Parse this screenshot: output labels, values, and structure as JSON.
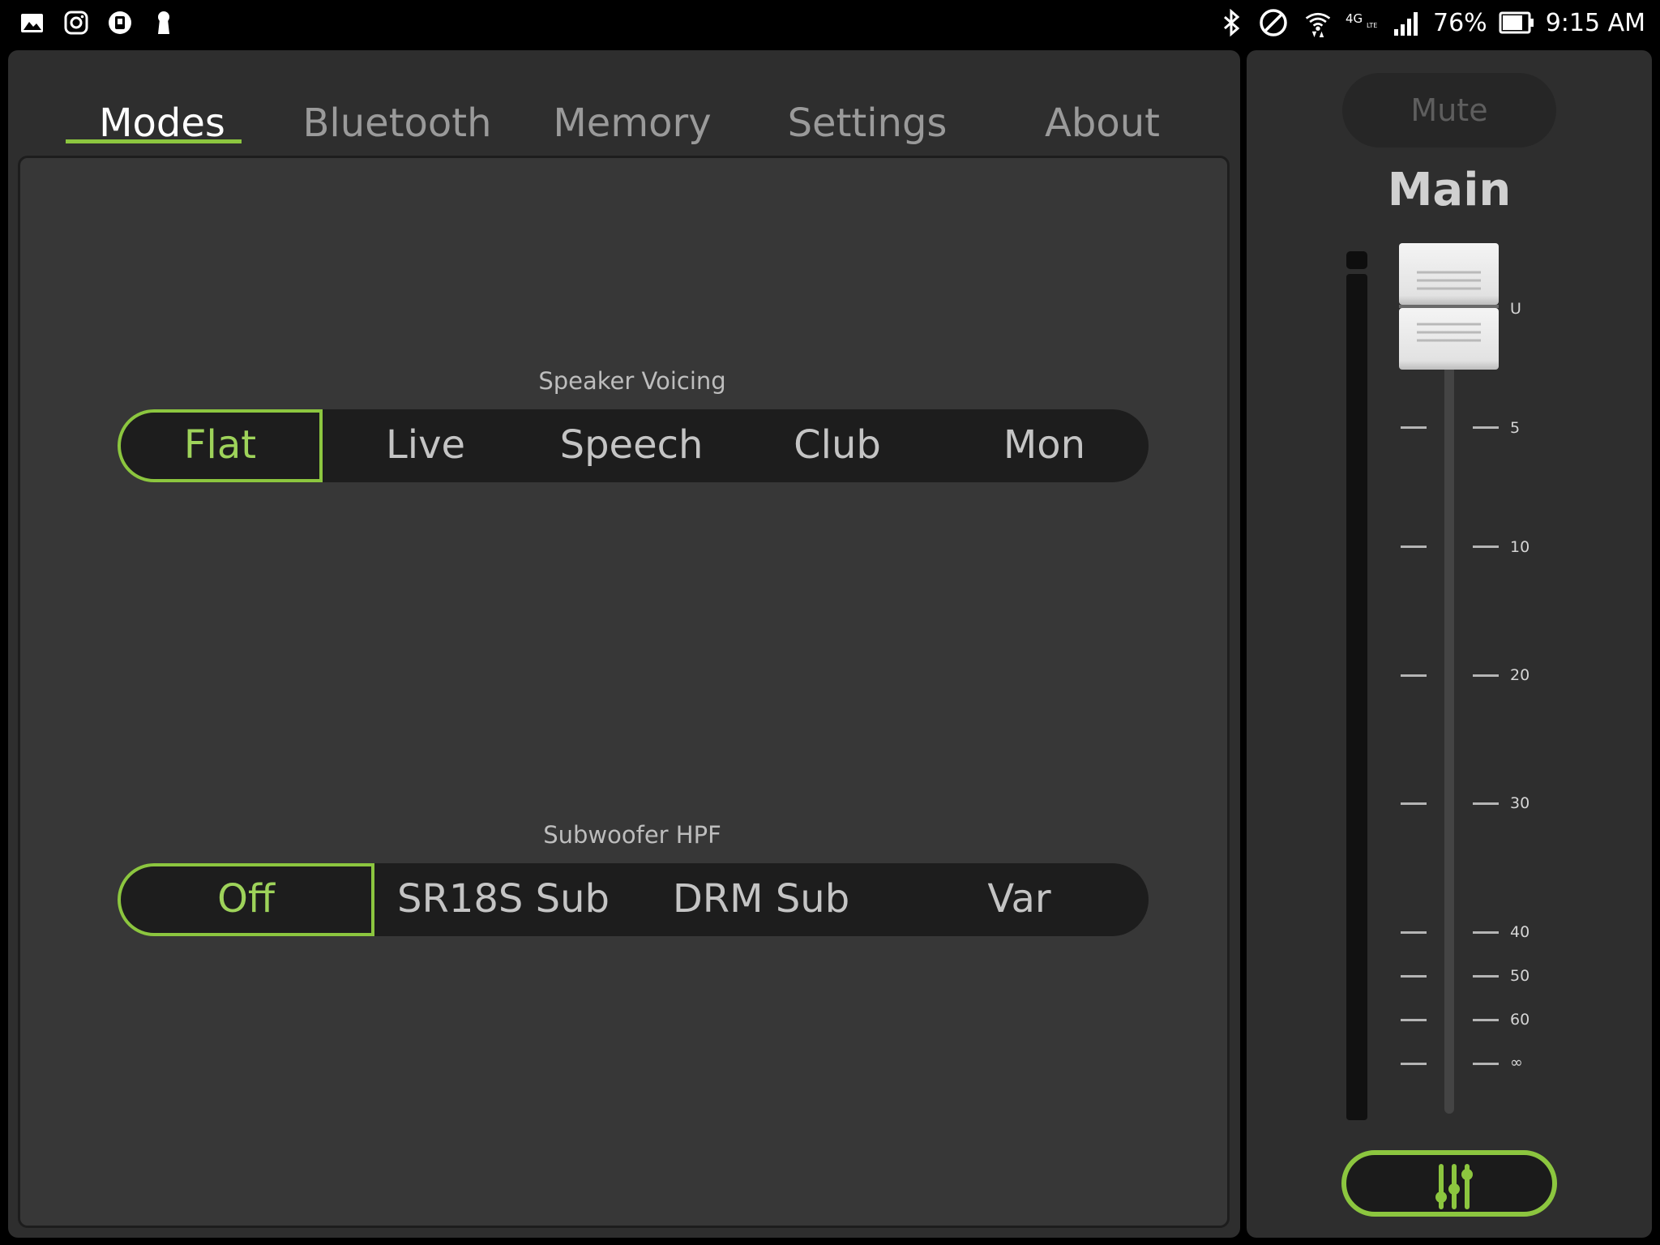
{
  "status_bar": {
    "left_icons": [
      "gallery-icon",
      "instagram-icon",
      "app-icon",
      "keyhole-icon"
    ],
    "right_icons": [
      "bluetooth-icon",
      "do-not-disturb-icon",
      "wifi-icon",
      "4g-lte-icon",
      "signal-icon"
    ],
    "battery_percent": "76%",
    "time": "9:15 AM"
  },
  "tabs": [
    {
      "label": "Modes",
      "active": true
    },
    {
      "label": "Bluetooth",
      "active": false
    },
    {
      "label": "Memory",
      "active": false
    },
    {
      "label": "Settings",
      "active": false
    },
    {
      "label": "About",
      "active": false
    }
  ],
  "speaker_voicing": {
    "label": "Speaker Voicing",
    "options": [
      "Flat",
      "Live",
      "Speech",
      "Club",
      "Mon"
    ],
    "selected": "Flat"
  },
  "subwoofer_hpf": {
    "label": "Subwoofer HPF",
    "options": [
      "Off",
      "SR18S Sub",
      "DRM Sub",
      "Var"
    ],
    "selected": "Off"
  },
  "fader": {
    "mute_label": "Mute",
    "channel_label": "Main",
    "scale_labels": [
      "U",
      "5",
      "10",
      "20",
      "30",
      "40",
      "50",
      "60",
      "∞"
    ],
    "level": "U"
  },
  "colors": {
    "accent": "#8cc63f",
    "panel": "#2e2e2e",
    "content": "#373737",
    "segment_bg": "#1d1d1d"
  }
}
